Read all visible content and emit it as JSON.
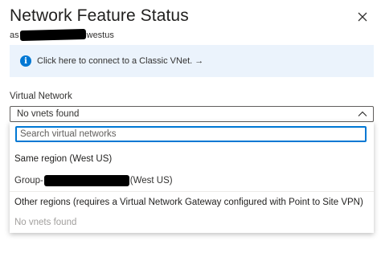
{
  "panel": {
    "title": "Network Feature Status",
    "close_icon": "close-icon",
    "subtitle_prefix": "as",
    "subtitle_suffix": "westus"
  },
  "info": {
    "icon": "info-icon",
    "icon_glyph": "i",
    "text": "Click here to connect to a Classic VNet. →"
  },
  "vnet_field": {
    "label": "Virtual Network",
    "selected": "No vnets found",
    "chevron_icon": "chevron-up-icon"
  },
  "dropdown_panel": {
    "search_placeholder": "Search virtual networks",
    "groups": [
      {
        "header": "Same region (West US)",
        "options": [
          {
            "prefix": "Group-",
            "suffix": "(West US)"
          }
        ]
      },
      {
        "header": "Other regions (requires a Virtual Network Gateway configured with Point to Site VPN)",
        "empty_text": "No vnets found"
      }
    ]
  },
  "colors": {
    "accent": "#0078d4",
    "info_background": "#ebf3fc",
    "text": "#323130",
    "disabled_text": "#a19f9d"
  }
}
